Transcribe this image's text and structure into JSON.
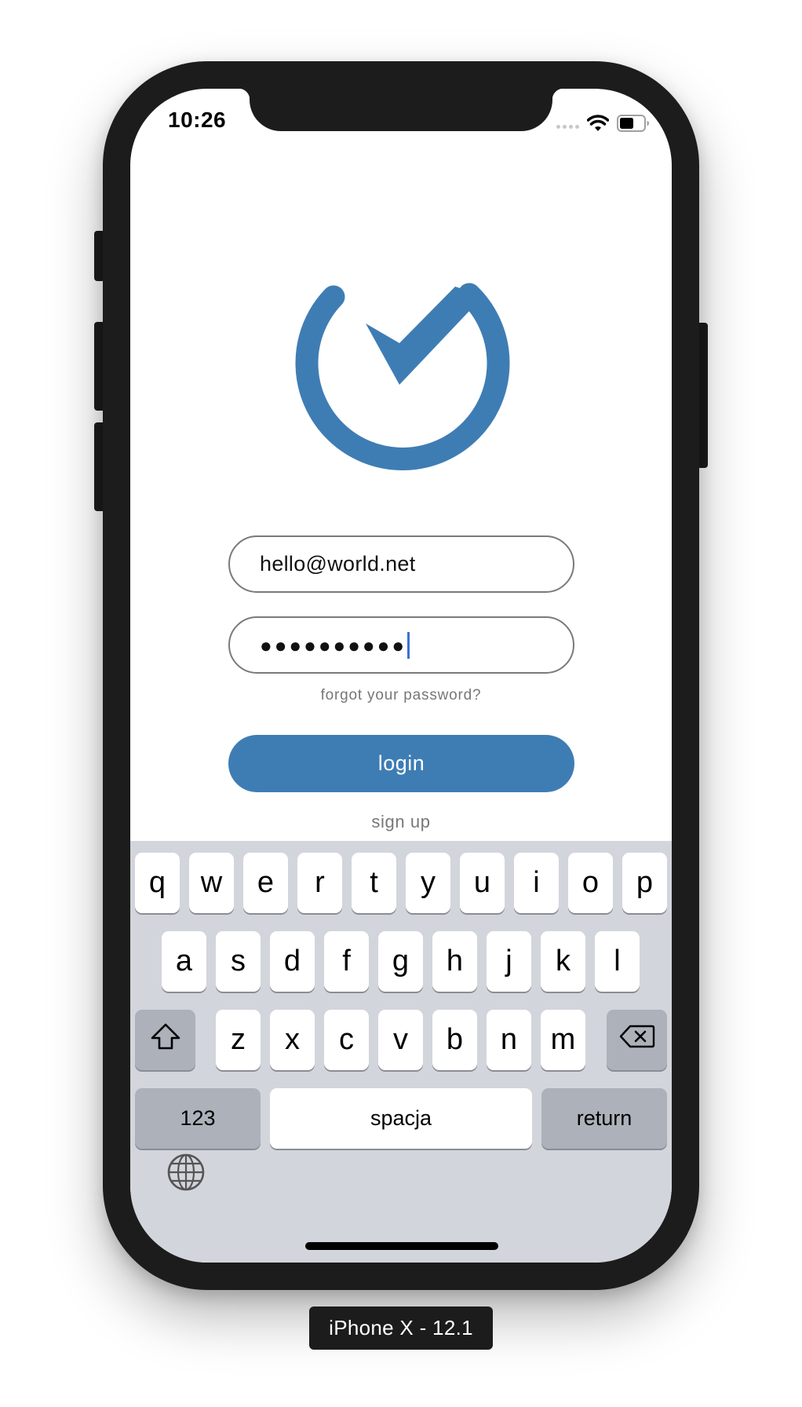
{
  "status_bar": {
    "time": "10:26",
    "icons": [
      "signal-dots",
      "wifi-icon",
      "battery-icon"
    ]
  },
  "logo": {
    "icon": "clock-check-logo",
    "color": "#3e7db4"
  },
  "form": {
    "email_value": "hello@world.net",
    "password_mask": "●●●●●●●●●●",
    "forgot_label": "forgot your password?",
    "login_label": "login",
    "signup_label": "sign up"
  },
  "keyboard": {
    "row1": [
      "q",
      "w",
      "e",
      "r",
      "t",
      "y",
      "u",
      "i",
      "o",
      "p"
    ],
    "row2": [
      "a",
      "s",
      "d",
      "f",
      "g",
      "h",
      "j",
      "k",
      "l"
    ],
    "row3": [
      "z",
      "x",
      "c",
      "v",
      "b",
      "n",
      "m"
    ],
    "numbers_label": "123",
    "space_label": "spacja",
    "return_label": "return",
    "icons": [
      "shift-icon",
      "backspace-icon",
      "globe-icon"
    ]
  },
  "device_label": "iPhone X - 12.1",
  "colors": {
    "accent": "#3e7db4",
    "keyboard_bg": "#d2d5db",
    "frame": "#1c1c1c",
    "caret": "#3b6fd6"
  }
}
